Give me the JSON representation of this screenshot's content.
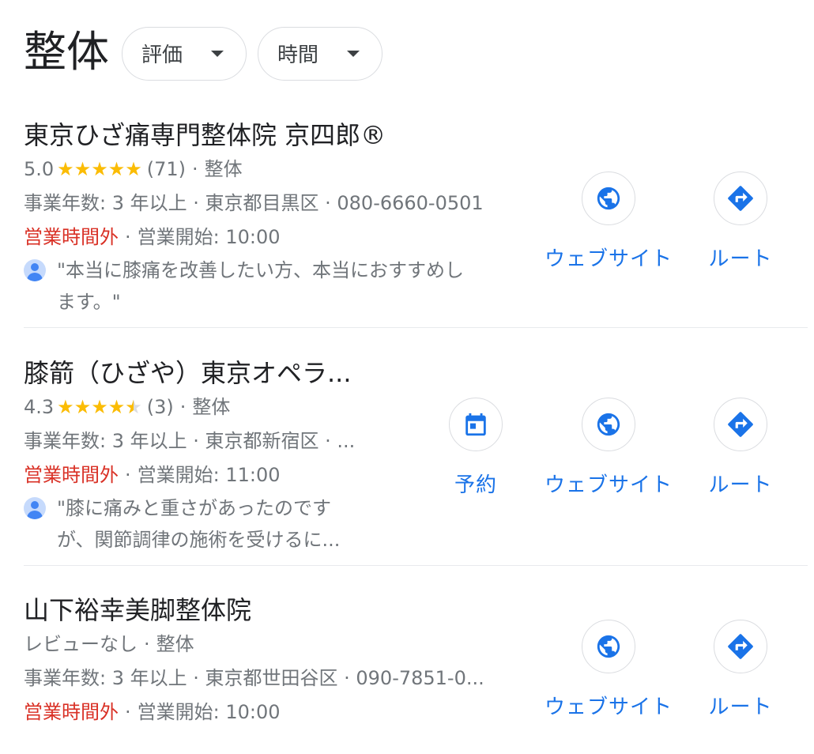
{
  "header": {
    "title": "整体",
    "filters": [
      {
        "label": "評価"
      },
      {
        "label": "時間"
      }
    ]
  },
  "listings": [
    {
      "name": "東京ひざ痛専門整体院 京四郎®",
      "rating": "5.0",
      "stars": 5,
      "review_count": "(71)",
      "category": "整体",
      "details": "事業年数: 3 年以上 · 東京都目黒区 · 080-6660-0501",
      "status": "営業時間外",
      "opening": "営業開始: 10:00",
      "review_line1": "\"本当に膝痛を改善したい方、本当におすすめし",
      "review_line2": "ます。\"",
      "actions": {
        "website": "ウェブサイト",
        "route": "ルート"
      }
    },
    {
      "name": "膝箭（ひざや）東京オペラ...",
      "rating": "4.3",
      "stars": 4.5,
      "review_count": "(3)",
      "category": "整体",
      "details": "事業年数: 3 年以上 · 東京都新宿区 · ...",
      "status": "営業時間外",
      "opening": "営業開始: 11:00",
      "review_line1": "\"膝に痛みと重さがあったのです",
      "review_line2": "が、関節調律の施術を受けるに...",
      "actions": {
        "reserve": "予約",
        "website": "ウェブサイト",
        "route": "ルート"
      }
    },
    {
      "name": "山下裕幸美脚整体院",
      "no_reviews": "レビューなし",
      "category": "整体",
      "details": "事業年数: 3 年以上 · 東京都世田谷区 · 090-7851-0...",
      "status": "営業時間外",
      "opening": "営業開始: 10:00",
      "actions": {
        "website": "ウェブサイト",
        "route": "ルート"
      }
    }
  ],
  "colors": {
    "link_blue": "#1a73e8",
    "star_yellow": "#fbbc04",
    "closed_red": "#d93025",
    "secondary_text": "#70757a"
  },
  "icons": [
    "globe-icon",
    "directions-icon",
    "calendar-icon",
    "chevron-down-icon",
    "avatar-icon",
    "star-icon"
  ]
}
